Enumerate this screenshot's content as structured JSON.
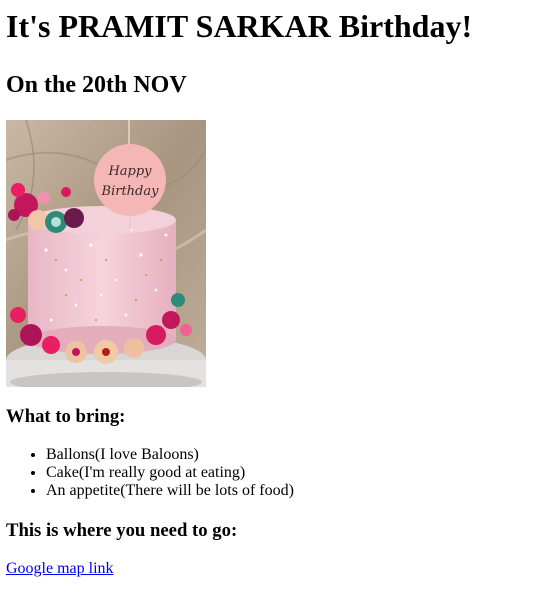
{
  "heading": "It's PRAMIT SARKAR Birthday!",
  "date_heading": "On the 20th NOV",
  "cake_image": {
    "topper_text_line1": "Happy",
    "topper_text_line2": "Birthday"
  },
  "bring_heading": "What to bring:",
  "bring_items": [
    "Ballons(I love Baloons)",
    "Cake(I'm really good at eating)",
    "An appetite(There will be lots of food)"
  ],
  "location_heading": "This is where you need to go:",
  "map_link_text": "Google map link",
  "colors": {
    "link": "#0000ee",
    "cake_pink": "#f2c9d4",
    "topper_pink": "#f4b7b5",
    "flower_magenta": "#d81b6a",
    "background_wall": "#b9a792"
  }
}
